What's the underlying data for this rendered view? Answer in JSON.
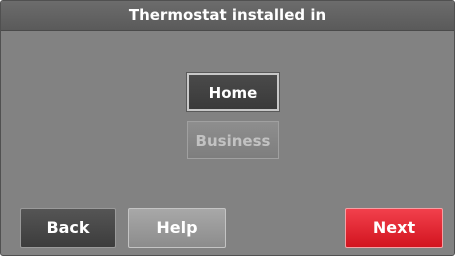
{
  "header": {
    "title": "Thermostat installed in"
  },
  "options": {
    "home_label": "Home",
    "business_label": "Business",
    "selected": "Home"
  },
  "footer": {
    "back_label": "Back",
    "help_label": "Help",
    "next_label": "Next"
  },
  "colors": {
    "background": "#828282",
    "selected_option": "#3f3f3f",
    "next_button": "#e01e2a"
  }
}
